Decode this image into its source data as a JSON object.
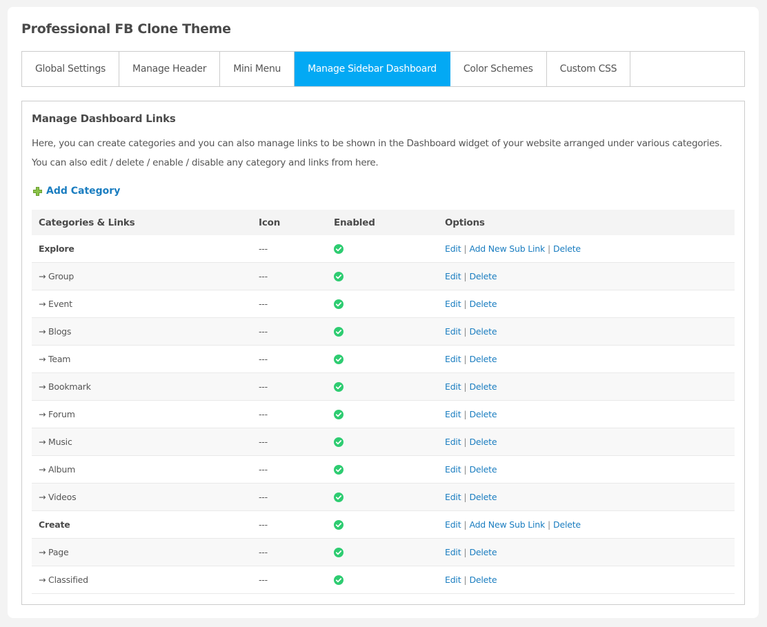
{
  "page": {
    "title": "Professional FB Clone Theme"
  },
  "tabs": [
    {
      "label": "Global Settings",
      "active": false
    },
    {
      "label": "Manage Header",
      "active": false
    },
    {
      "label": "Mini Menu",
      "active": false
    },
    {
      "label": "Manage Sidebar Dashboard",
      "active": true
    },
    {
      "label": "Color Schemes",
      "active": false
    },
    {
      "label": "Custom CSS",
      "active": false
    }
  ],
  "section": {
    "title": "Manage Dashboard Links",
    "description": "Here, you can create categories and you can also manage links to be shown in the Dashboard widget of your website arranged under various categories. You can also edit / delete / enable / disable any category and links from here.",
    "add_category_label": "Add Category"
  },
  "table": {
    "headers": {
      "name": "Categories & Links",
      "icon": "Icon",
      "enabled": "Enabled",
      "options": "Options"
    },
    "option_labels": {
      "edit": "Edit",
      "add_sub": "Add New Sub Link",
      "delete": "Delete",
      "separator": "|"
    },
    "colors": {
      "enabled": "#2ecc71",
      "link": "#1a7dc0",
      "active_tab": "#03a9f4"
    },
    "rows": [
      {
        "name": "Explore",
        "type": "category",
        "icon": "---",
        "enabled": true
      },
      {
        "name": "→ Group",
        "type": "link",
        "icon": "---",
        "enabled": true
      },
      {
        "name": "→ Event",
        "type": "link",
        "icon": "---",
        "enabled": true
      },
      {
        "name": "→ Blogs",
        "type": "link",
        "icon": "---",
        "enabled": true
      },
      {
        "name": "→ Team",
        "type": "link",
        "icon": "---",
        "enabled": true
      },
      {
        "name": "→ Bookmark",
        "type": "link",
        "icon": "---",
        "enabled": true
      },
      {
        "name": "→ Forum",
        "type": "link",
        "icon": "---",
        "enabled": true
      },
      {
        "name": "→ Music",
        "type": "link",
        "icon": "---",
        "enabled": true
      },
      {
        "name": "→ Album",
        "type": "link",
        "icon": "---",
        "enabled": true
      },
      {
        "name": "→ Videos",
        "type": "link",
        "icon": "---",
        "enabled": true
      },
      {
        "name": "Create",
        "type": "category",
        "icon": "---",
        "enabled": true
      },
      {
        "name": "→ Page",
        "type": "link",
        "icon": "---",
        "enabled": true
      },
      {
        "name": "→ Classified",
        "type": "link",
        "icon": "---",
        "enabled": true
      }
    ]
  }
}
